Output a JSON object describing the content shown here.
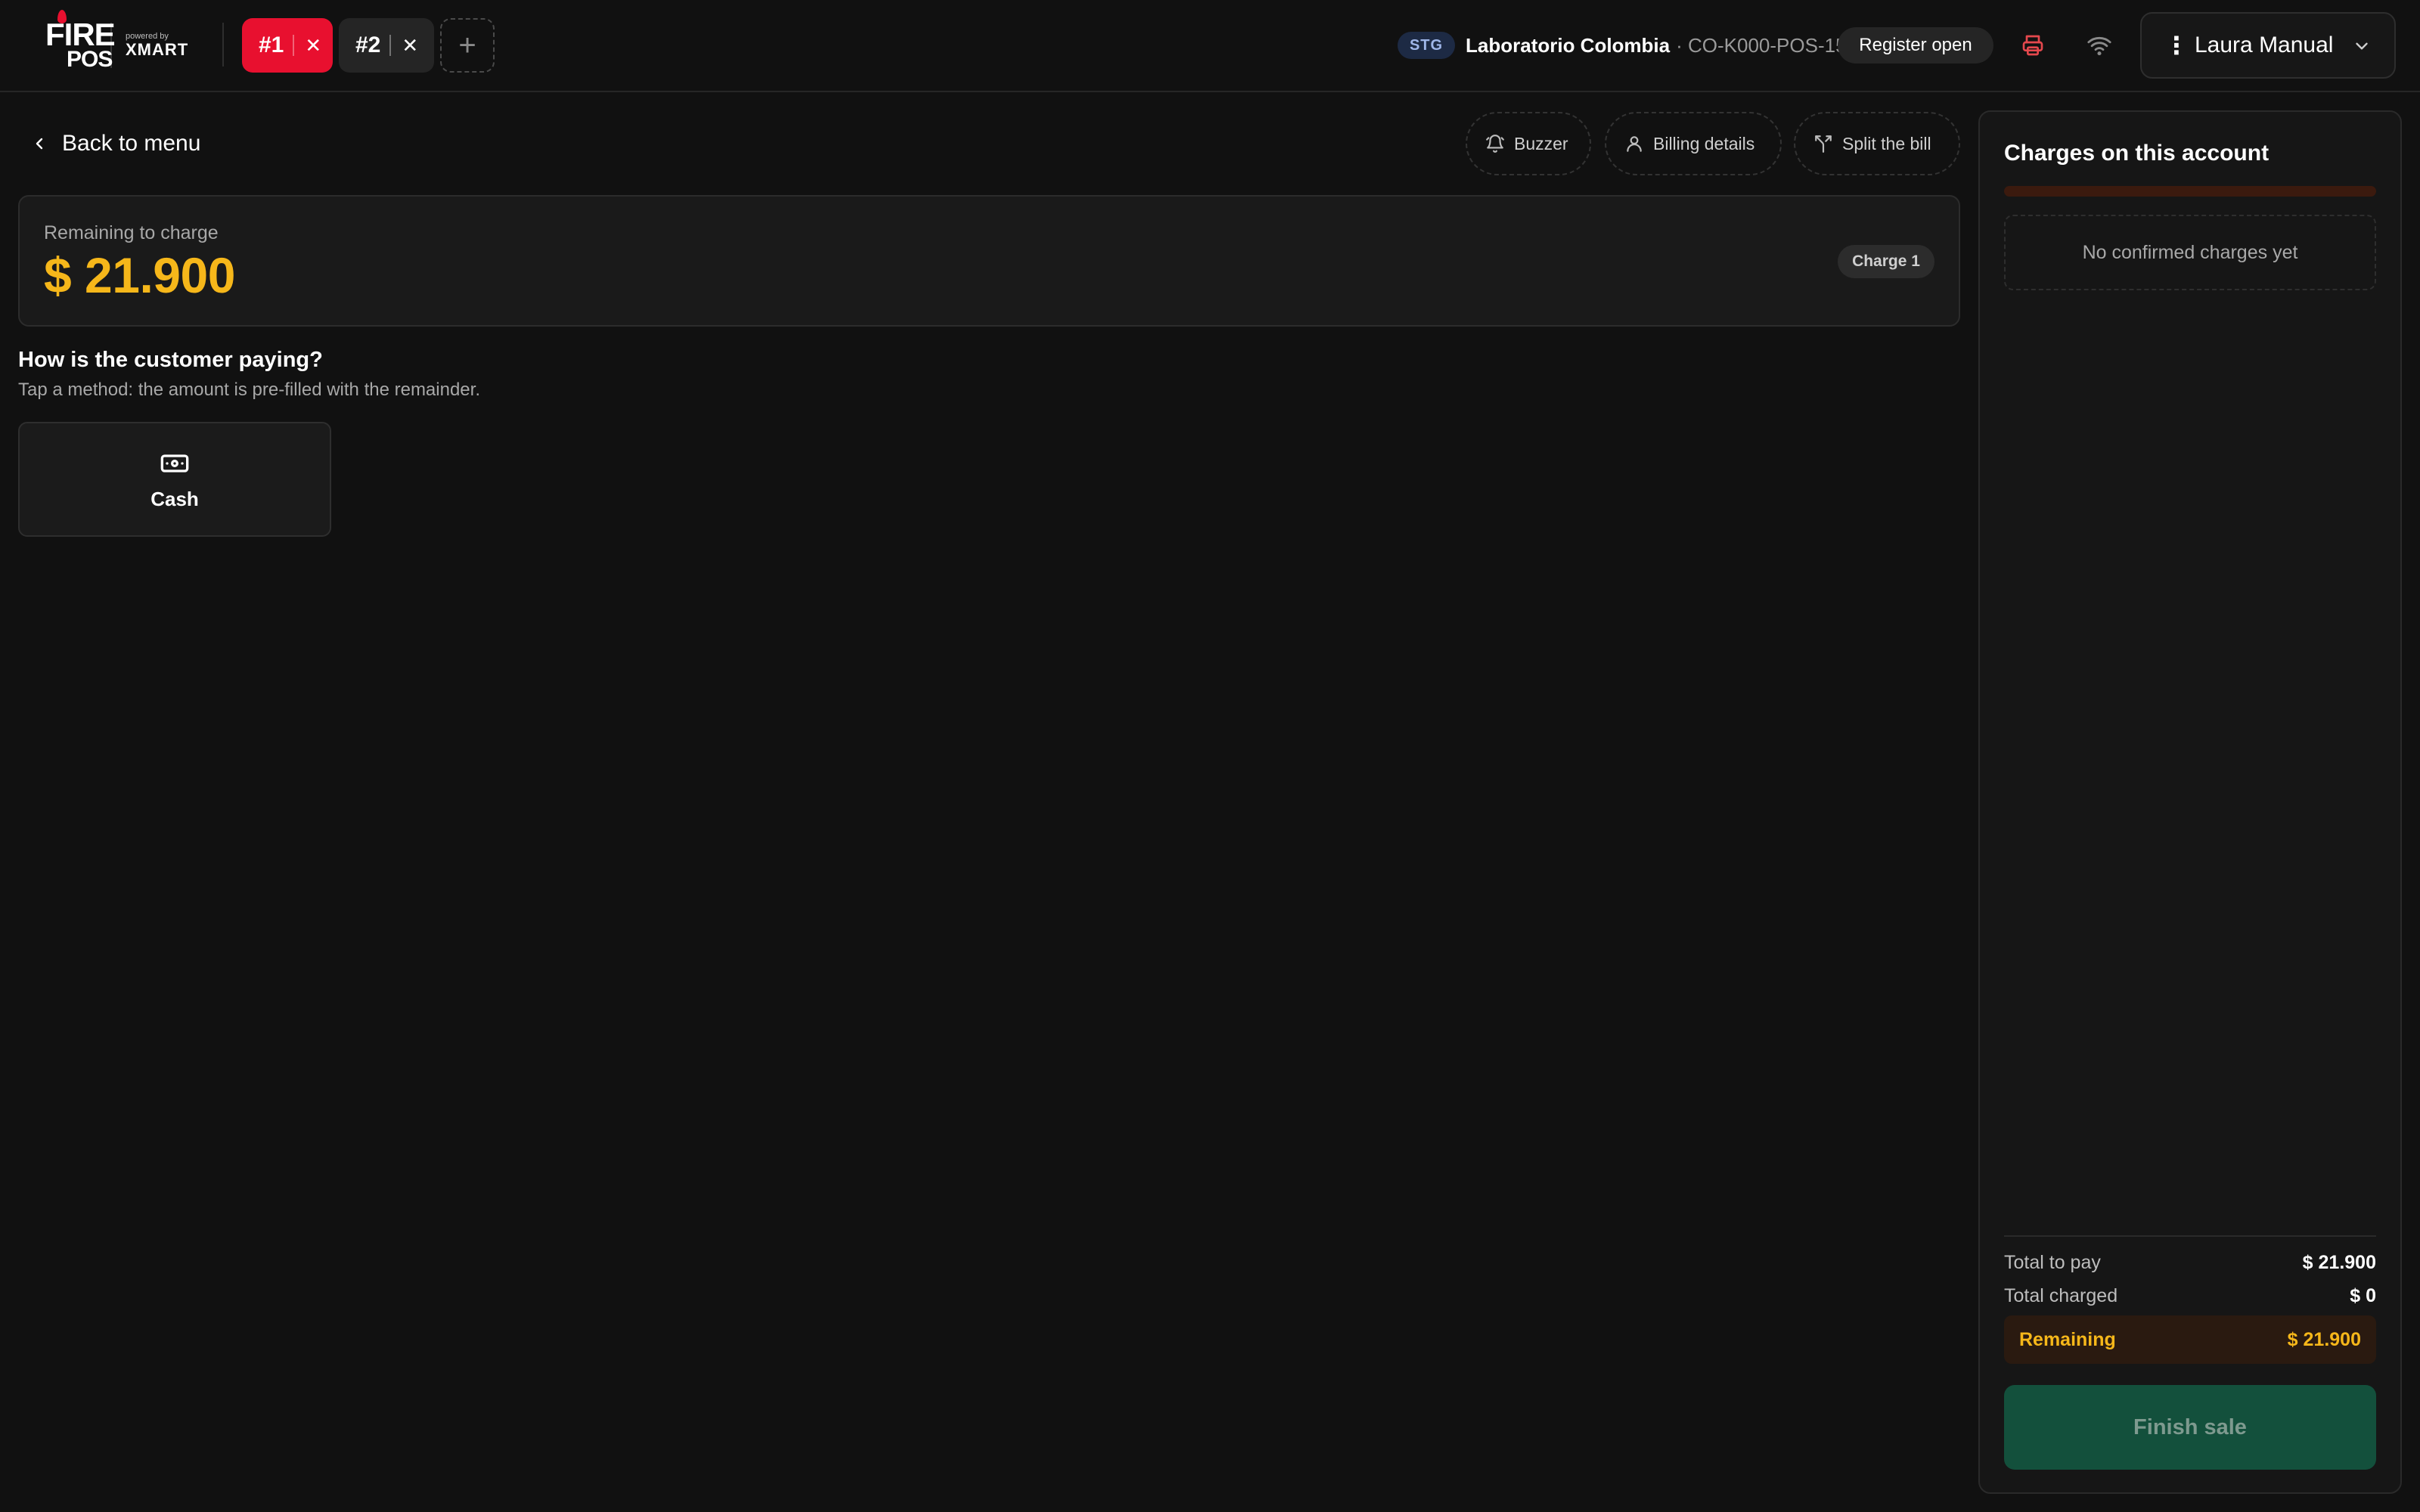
{
  "logo": {
    "brand_top": "FIRE",
    "brand_bottom": "POS",
    "powered_by": "powered by",
    "partner": "XMART"
  },
  "tabs": [
    {
      "label": "#1",
      "active": true
    },
    {
      "label": "#2",
      "active": false
    }
  ],
  "header": {
    "env_badge": "STG",
    "store_name": "Laboratorio Colombia",
    "store_code": "· CO-K000-POS-15",
    "register_status": "Register open",
    "user_name": "Laura Manual"
  },
  "colors": {
    "accent_red": "#e8102f",
    "amount_yellow": "#f6b71a",
    "finish_green": "#13503c"
  },
  "main": {
    "back_label": "Back to menu",
    "actions": {
      "buzzer": "Buzzer",
      "billing": "Billing details",
      "split": "Split the bill"
    },
    "remaining_label": "Remaining to charge",
    "remaining_amount": "$ 21.900",
    "charge_badge": "Charge 1",
    "question_title": "How is the customer paying?",
    "question_sub": "Tap a method: the amount is pre-filled with the remainder.",
    "methods": [
      {
        "label": "Cash",
        "icon": "cash-icon"
      }
    ]
  },
  "panel": {
    "title": "Charges on this account",
    "charged_fraction": 0,
    "empty_text": "No confirmed charges yet",
    "total_to_pay_label": "Total to pay",
    "total_to_pay": "$ 21.900",
    "total_charged_label": "Total charged",
    "total_charged": "$ 0",
    "remaining_label": "Remaining",
    "remaining": "$ 21.900",
    "finish_label": "Finish sale"
  }
}
